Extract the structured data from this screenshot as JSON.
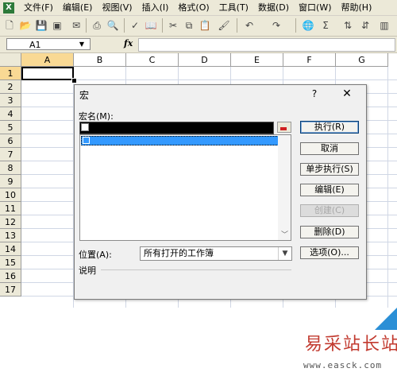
{
  "menubar": {
    "items": [
      "文件(F)",
      "编辑(E)",
      "视图(V)",
      "插入(I)",
      "格式(O)",
      "工具(T)",
      "数据(D)",
      "窗口(W)",
      "帮助(H)"
    ]
  },
  "formula_bar": {
    "name_box": "A1",
    "fx": "fx"
  },
  "grid": {
    "columns": [
      "A",
      "B",
      "C",
      "D",
      "E",
      "F",
      "G"
    ],
    "rows": [
      "1",
      "2",
      "3",
      "4",
      "5",
      "6",
      "7",
      "8",
      "9",
      "10",
      "11",
      "12",
      "13",
      "14",
      "15",
      "16",
      "17"
    ],
    "active_cell": "A1"
  },
  "dialog": {
    "title": "宏",
    "help": "?",
    "close": "✕",
    "macro_name_label": "宏名(M):",
    "buttons": {
      "run": "执行(R)",
      "cancel": "取消",
      "step_into": "单步执行(S)",
      "edit": "编辑(E)",
      "create": "创建(C)",
      "delete": "删除(D)",
      "options": "选项(O)..."
    },
    "location_label": "位置(A):",
    "location_value": "所有打开的工作簿",
    "description_label": "说明"
  },
  "watermark": {
    "title": "易采站长站",
    "url": "www.easck.com"
  }
}
